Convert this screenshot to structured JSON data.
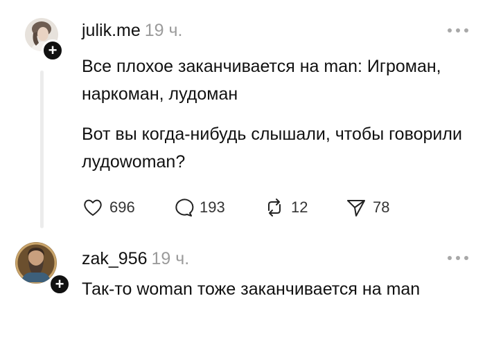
{
  "posts": [
    {
      "username": "julik.me",
      "time": "19 ч.",
      "paragraphs": [
        "Все плохое заканчивается на man: Игроман, наркоман, лудоман",
        "Вот вы когда-нибудь слышали, чтобы говорили лудоwoman?"
      ],
      "likes": "696",
      "comments": "193",
      "reposts": "12",
      "shares": "78"
    },
    {
      "username": "zak_956",
      "time": "19 ч.",
      "paragraphs": [
        "Так-то woman тоже заканчивается на man"
      ]
    }
  ],
  "icons": {
    "follow": "+",
    "more": "more-icon",
    "like": "heart-icon",
    "comment": "comment-icon",
    "repost": "repost-icon",
    "share": "send-icon"
  },
  "colors": {
    "text": "#111111",
    "muted": "#9b9b9b",
    "thread_line": "#ececec"
  }
}
